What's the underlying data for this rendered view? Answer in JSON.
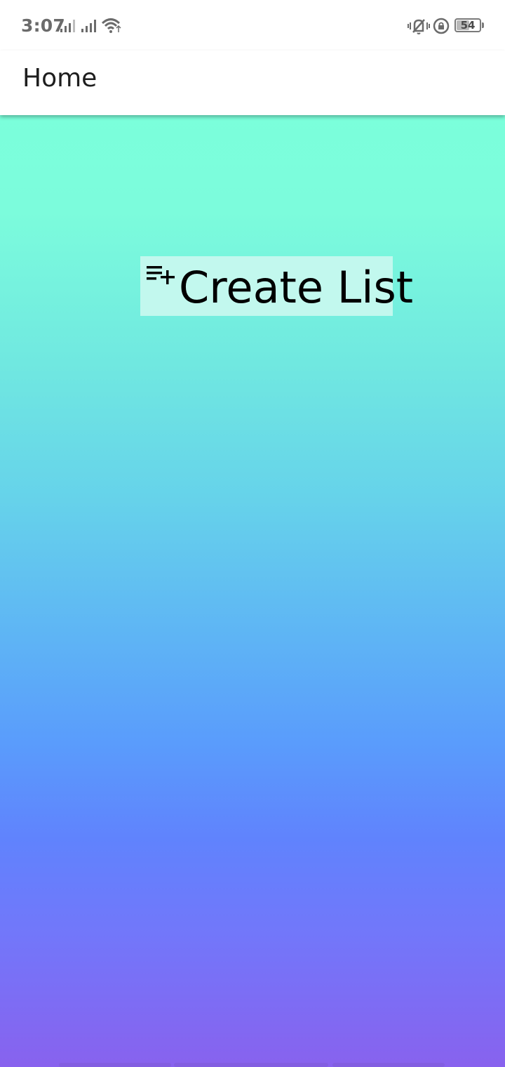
{
  "status_bar": {
    "time": "3:07",
    "battery_level": "54",
    "icons": [
      "signal-icon",
      "signal-icon",
      "wifi-icon",
      "vibrate-icon",
      "rotation-lock-icon",
      "battery-icon"
    ]
  },
  "app_bar": {
    "title": "Home"
  },
  "main": {
    "create_button": {
      "label": "Create List",
      "icon": "playlist-add-icon"
    }
  },
  "colors": {
    "gradient_top": "#7bffdb",
    "gradient_mid": "#5a9cfc",
    "gradient_bottom": "#8862ee",
    "button_bg": "#c2f8ee"
  }
}
